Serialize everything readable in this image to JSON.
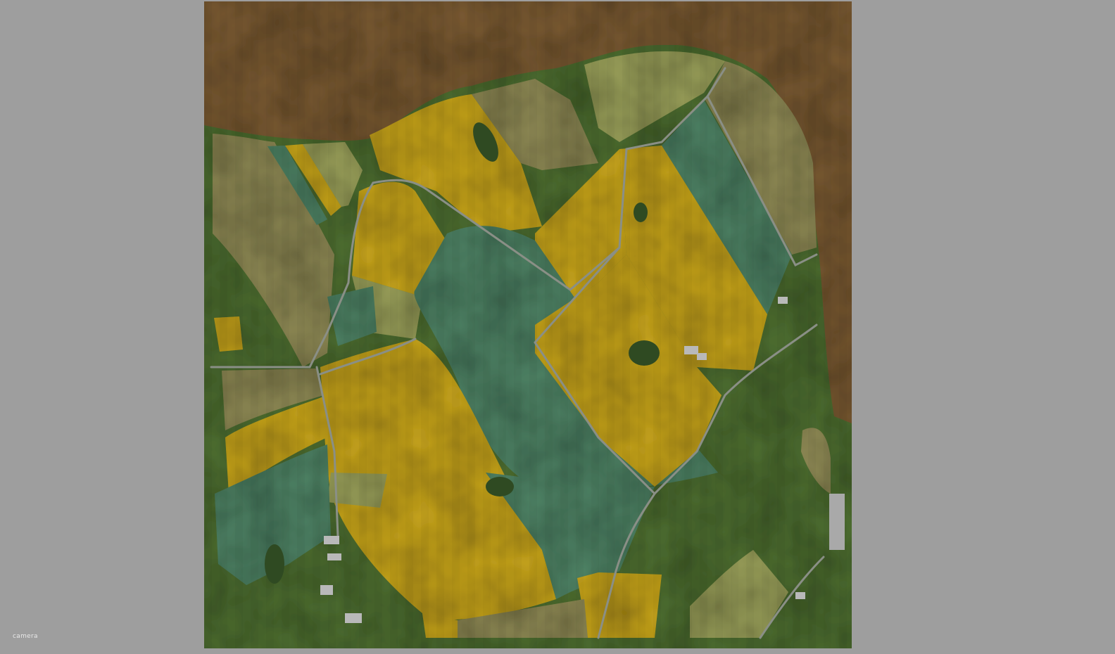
{
  "viewport": {
    "label": "camera"
  },
  "map": {
    "colors": {
      "background": "#9e9e9e",
      "water": "#7a5a32",
      "grass": "#4e6f31",
      "canola": "#c9a61c",
      "green_crop": "#4f8466",
      "wheat": "#8f8a55",
      "light_crop": "#9aa05a",
      "road": "#8a8f86",
      "building": "#b9b9b9"
    }
  }
}
